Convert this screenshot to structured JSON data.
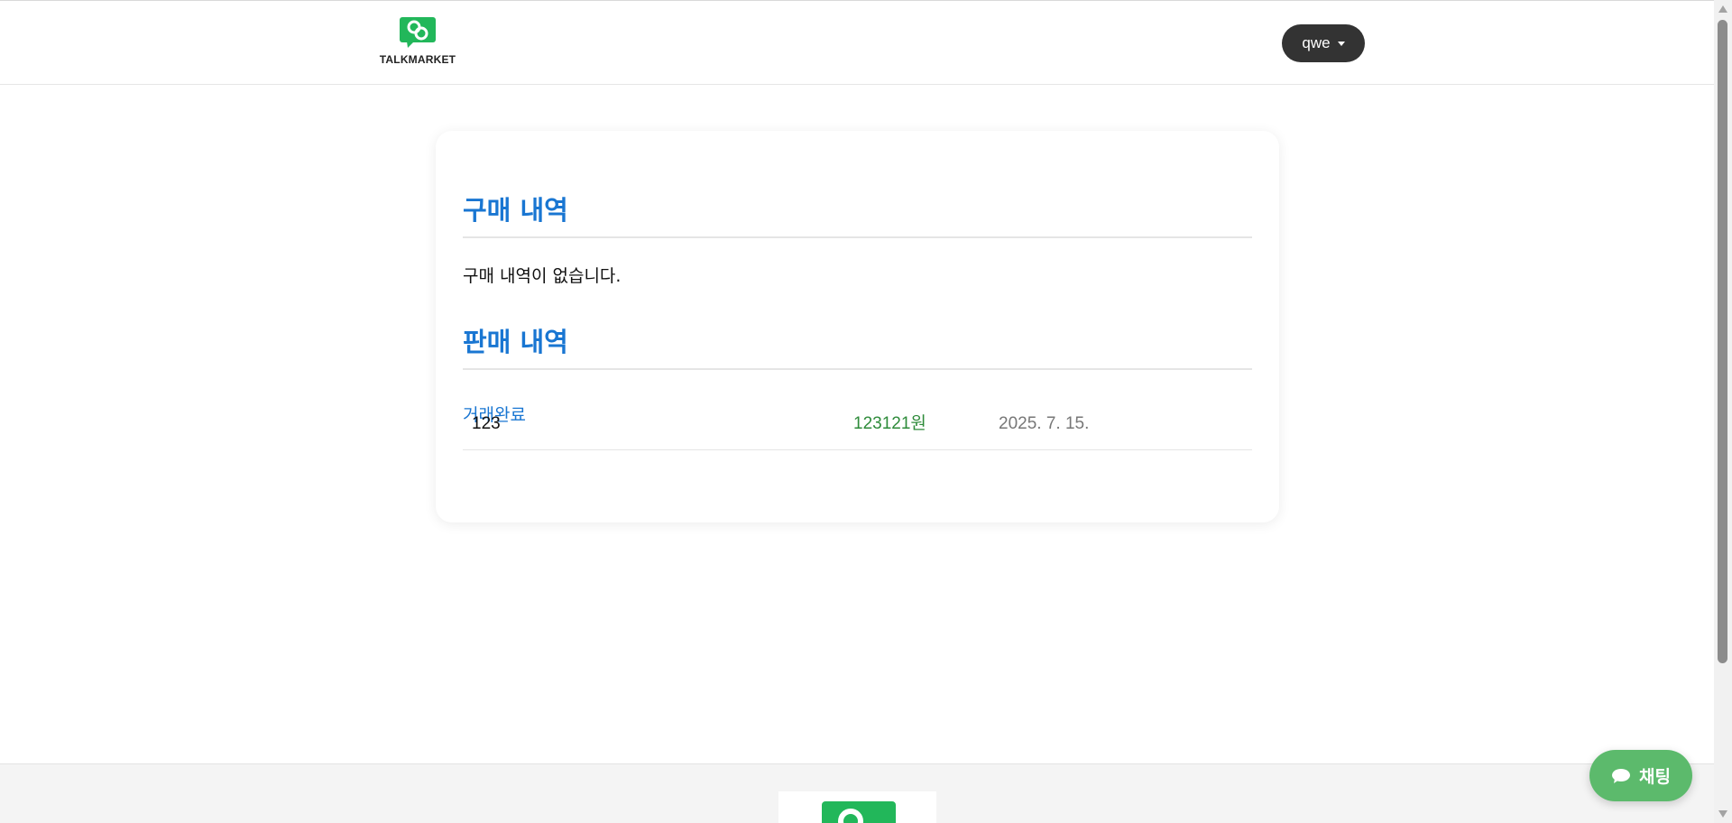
{
  "header": {
    "logo_text": "TALKMARKET",
    "user_menu_label": "qwe"
  },
  "purchases": {
    "title": "구매 내역",
    "empty_message": "구매 내역이 없습니다."
  },
  "sales": {
    "title": "판매 내역",
    "items": [
      {
        "name": "123",
        "price": "123121원",
        "date": "2025. 7. 15.",
        "status": "거래완료"
      }
    ]
  },
  "chat": {
    "label": "채팅"
  },
  "colors": {
    "brand_green": "#22b75a",
    "section_title_blue": "#1976d2",
    "price_green": "#2e8b3a",
    "chat_button": "#5cba6c",
    "user_button": "#333333"
  },
  "icons": {
    "logo": "talkmarket-logo-icon",
    "user_caret": "caret-down-icon",
    "chat": "chat-bubble-icon"
  }
}
